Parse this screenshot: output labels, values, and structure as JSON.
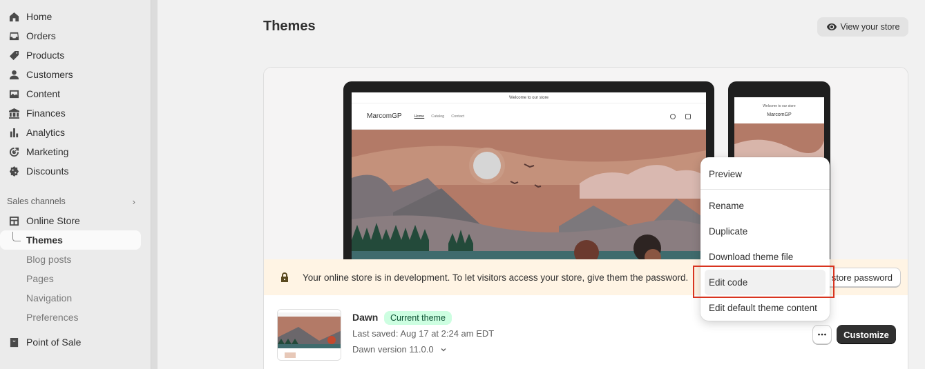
{
  "sidebar": {
    "items": [
      {
        "label": "Home",
        "icon": "home-icon"
      },
      {
        "label": "Orders",
        "icon": "inbox-icon"
      },
      {
        "label": "Products",
        "icon": "tag-icon"
      },
      {
        "label": "Customers",
        "icon": "person-icon"
      },
      {
        "label": "Content",
        "icon": "image-icon"
      },
      {
        "label": "Finances",
        "icon": "bank-icon"
      },
      {
        "label": "Analytics",
        "icon": "bar-chart-icon"
      },
      {
        "label": "Marketing",
        "icon": "target-icon"
      },
      {
        "label": "Discounts",
        "icon": "discount-icon"
      }
    ],
    "sales_channels_label": "Sales channels",
    "online_store": "Online Store",
    "sub_items": [
      "Themes",
      "Blog posts",
      "Pages",
      "Navigation",
      "Preferences"
    ],
    "point_of_sale": "Point of Sale"
  },
  "header": {
    "title": "Themes",
    "view_store": "View your store"
  },
  "preview": {
    "announcement": "Welcome to our store",
    "store_name": "MarcomGP",
    "links": [
      "Home",
      "Catalog",
      "Contact"
    ],
    "hero_colors": {
      "sky": "#b07865",
      "sun": "#d8d8d8",
      "mountain": "#6e6a6d",
      "trees": "#234a3a",
      "water": "#3f6b6d"
    }
  },
  "banner": {
    "text": "Your online store is in development. To let visitors access your store, give them the password.",
    "button": "store password"
  },
  "theme": {
    "name": "Dawn",
    "badge": "Current theme",
    "last_saved": "Last saved: Aug 17 at 2:24 am EDT",
    "version": "Dawn version 11.0.0",
    "customize": "Customize"
  },
  "menu": {
    "items": [
      "Preview",
      "Rename",
      "Duplicate",
      "Download theme file",
      "Edit code",
      "Edit default theme content"
    ]
  },
  "colors": {
    "accent_dark": "#303030",
    "badge_bg": "#cdfee1",
    "banner_bg": "#fff4e4",
    "highlight_red": "#d8341f"
  }
}
